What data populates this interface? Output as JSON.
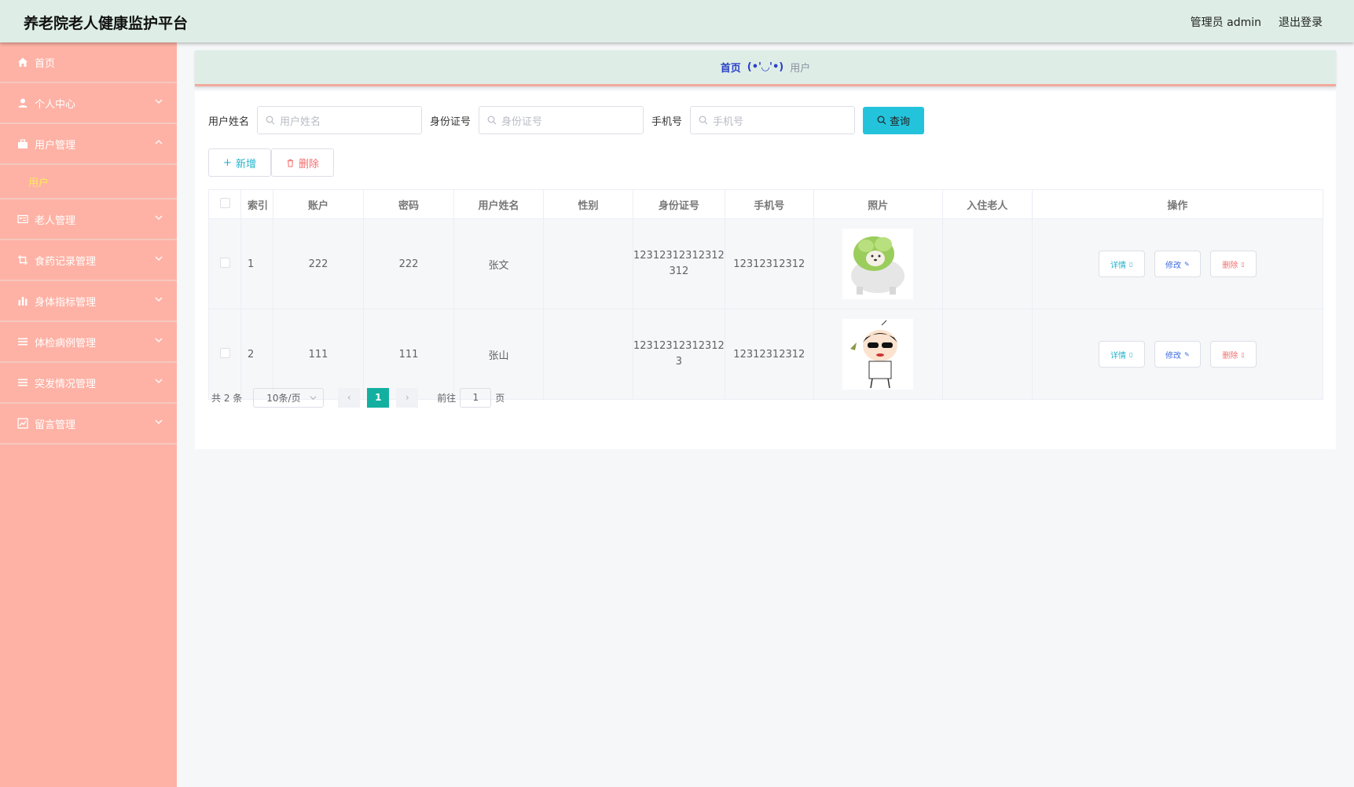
{
  "header": {
    "title": "养老院老人健康监护平台",
    "user_label": "管理员 admin",
    "logout_label": "退出登录"
  },
  "sidebar": {
    "items": [
      {
        "label": "首页",
        "icon": "home-icon"
      },
      {
        "label": "个人中心",
        "icon": "user-icon"
      },
      {
        "label": "用户管理",
        "icon": "briefcase-icon",
        "expanded": true,
        "sub": [
          "用户"
        ]
      },
      {
        "label": "老人管理",
        "icon": "idcard-icon"
      },
      {
        "label": "食药记录管理",
        "icon": "crop-icon"
      },
      {
        "label": "身体指标管理",
        "icon": "bar-chart-icon"
      },
      {
        "label": "体检病例管理",
        "icon": "list-icon"
      },
      {
        "label": "突发情况管理",
        "icon": "list-icon"
      },
      {
        "label": "留言管理",
        "icon": "chart-box-icon"
      }
    ]
  },
  "breadcrumb": {
    "home": "首页",
    "face": "(•'◡'•)",
    "current": "用户"
  },
  "search": {
    "name_label": "用户姓名",
    "name_placeholder": "用户姓名",
    "idcard_label": "身份证号",
    "idcard_placeholder": "身份证号",
    "phone_label": "手机号",
    "phone_placeholder": "手机号",
    "query_label": "查询"
  },
  "actions": {
    "add_label": "新增",
    "delete_label": "删除"
  },
  "table": {
    "headers": [
      "索引",
      "账户",
      "密码",
      "用户姓名",
      "性别",
      "身份证号",
      "手机号",
      "照片",
      "入住老人",
      "操作"
    ],
    "rows": [
      {
        "index": "1",
        "account": "222",
        "password": "222",
        "name": "张文",
        "gender": "",
        "idcard_1": "12312312312312",
        "idcard_2": "312",
        "phone": "12312312312",
        "elder": ""
      },
      {
        "index": "2",
        "account": "111",
        "password": "111",
        "name": "张山",
        "gender": "",
        "idcard_1": "12312312312312",
        "idcard_2": "3",
        "phone": "12312312312",
        "elder": ""
      }
    ],
    "op_detail": "详情",
    "op_edit": "修改",
    "op_delete": "删除"
  },
  "pagination": {
    "total": "共 2 条",
    "page_size": "10条/页",
    "current": "1",
    "goto_prefix": "前往",
    "goto_value": "1",
    "goto_suffix": "页"
  },
  "colors": {
    "sidebar": "#feb2a5",
    "topbar": "#deeee7",
    "accent": "#23c3dc",
    "submenu_active": "#ffe95a"
  }
}
